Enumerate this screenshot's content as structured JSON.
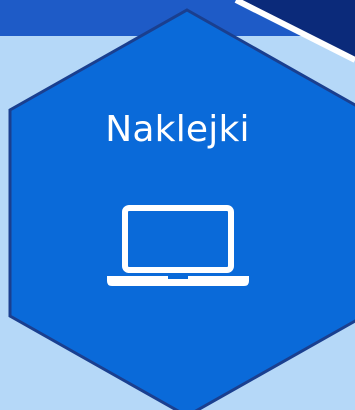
{
  "tile": {
    "title": "Naklejki",
    "icon": "laptop-icon"
  },
  "colors": {
    "background_light": "#b5d8f8",
    "banner": "#1e5bc7",
    "banner_dark": "#0b2a7a",
    "hexagon_fill": "#0a6ad9",
    "hexagon_border": "#1a3f8f",
    "icon": "#ffffff"
  }
}
